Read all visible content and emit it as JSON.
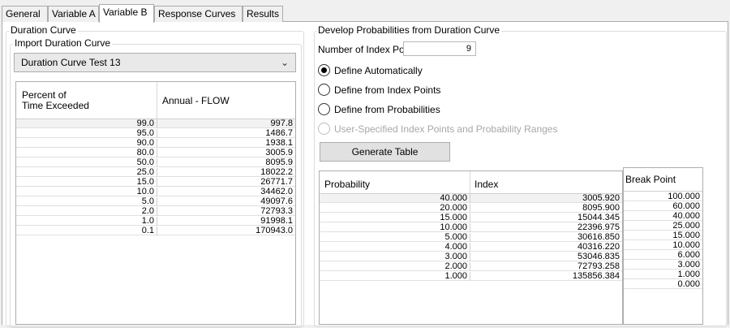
{
  "tabs": [
    {
      "label": "General"
    },
    {
      "label": "Variable A"
    },
    {
      "label": "Variable B"
    },
    {
      "label": "Response Curves"
    },
    {
      "label": "Results"
    }
  ],
  "left": {
    "group_title": "Duration Curve",
    "import_title": "Import Duration Curve",
    "selected_curve": "Duration Curve Test 13",
    "table": {
      "col1_header_line1": "Percent of",
      "col1_header_line2": "Time Exceeded",
      "col2_header": "Annual - FLOW",
      "rows": [
        {
          "pct": "99.0",
          "flow": "997.8"
        },
        {
          "pct": "95.0",
          "flow": "1486.7"
        },
        {
          "pct": "90.0",
          "flow": "1938.1"
        },
        {
          "pct": "80.0",
          "flow": "3005.9"
        },
        {
          "pct": "50.0",
          "flow": "8095.9"
        },
        {
          "pct": "25.0",
          "flow": "18022.2"
        },
        {
          "pct": "15.0",
          "flow": "26771.7"
        },
        {
          "pct": "10.0",
          "flow": "34462.0"
        },
        {
          "pct": "5.0",
          "flow": "49097.6"
        },
        {
          "pct": "2.0",
          "flow": "72793.3"
        },
        {
          "pct": "1.0",
          "flow": "91998.1"
        },
        {
          "pct": "0.1",
          "flow": "170943.0"
        }
      ]
    }
  },
  "right": {
    "group_title": "Develop Probabilities from Duration Curve",
    "index_points_label": "Number of Index Points",
    "index_points_value": "9",
    "radios": [
      {
        "label": "Define Automatically",
        "checked": true,
        "disabled": false
      },
      {
        "label": "Define from Index Points",
        "checked": false,
        "disabled": false
      },
      {
        "label": "Define from Probabilities",
        "checked": false,
        "disabled": false
      },
      {
        "label": "User-Specified Index Points and Probability Ranges",
        "checked": false,
        "disabled": true
      }
    ],
    "generate_button": "Generate Table",
    "prob_table": {
      "col1_header": "Probability",
      "col2_header": "Index",
      "rows": [
        {
          "prob": "40.000",
          "index": "3005.920"
        },
        {
          "prob": "20.000",
          "index": "8095.900"
        },
        {
          "prob": "15.000",
          "index": "15044.345"
        },
        {
          "prob": "10.000",
          "index": "22396.975"
        },
        {
          "prob": "5.000",
          "index": "30616.850"
        },
        {
          "prob": "4.000",
          "index": "40316.220"
        },
        {
          "prob": "3.000",
          "index": "53046.835"
        },
        {
          "prob": "2.000",
          "index": "72793.258"
        },
        {
          "prob": "1.000",
          "index": "135856.384"
        }
      ]
    },
    "break_table": {
      "header": "Break Point",
      "rows": [
        "100.000",
        "60.000",
        "40.000",
        "25.000",
        "15.000",
        "10.000",
        "6.000",
        "3.000",
        "1.000",
        "0.000"
      ]
    }
  }
}
